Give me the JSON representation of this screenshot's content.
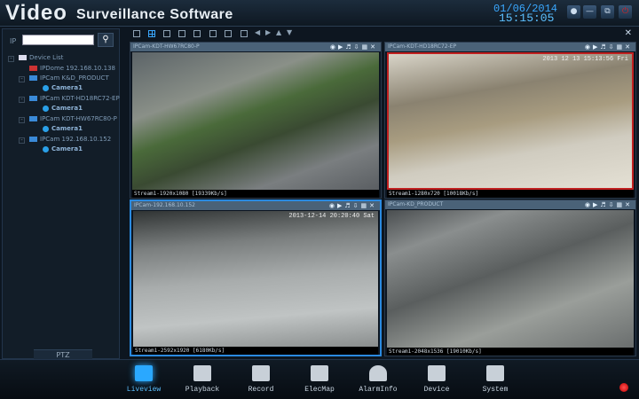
{
  "app": {
    "title_big": "Video",
    "title_rest": "Surveillance Software",
    "date": "01/06/2014",
    "time": "15:15:05"
  },
  "window_buttons": [
    "lock",
    "minimize",
    "restore",
    "power"
  ],
  "sidebar": {
    "ip_label": "IP",
    "ip_value": "",
    "tree": [
      {
        "label": "Device List",
        "type": "root"
      },
      {
        "label": "IPDome 192.168.10.138",
        "type": "device",
        "status": "offline"
      },
      {
        "label": "IPCam K&D_PRODUCT",
        "type": "device"
      },
      {
        "label": "Camera1",
        "type": "camera"
      },
      {
        "label": "IPCam KDT-HD18RC72-EP",
        "type": "device"
      },
      {
        "label": "Camera1",
        "type": "camera"
      },
      {
        "label": "IPCam KDT-HW67RC80-P",
        "type": "device"
      },
      {
        "label": "Camera1",
        "type": "camera"
      },
      {
        "label": "IPCam 192.168.10.152",
        "type": "device"
      },
      {
        "label": "Camera1",
        "type": "camera"
      }
    ],
    "ptz_label": "PTZ"
  },
  "cells": [
    {
      "title": "IPCam-KDT-HW67RC80-P",
      "stream": "Stream1-1920x1080 [19339Kb/s]",
      "osd": ""
    },
    {
      "title": "IPCam-KDT-HD18RC72-EP",
      "stream": "Stream1-1280x720 [10018Kb/s]",
      "osd": "2013 12 13 15:13:56 Fri"
    },
    {
      "title": "IPCam-192.168.10.152",
      "stream": "Stream1-2592x1920 [6180Kb/s]",
      "osd": "2013-12-14 20:20:40 Sat"
    },
    {
      "title": "IPCam-KD_PRODUCT",
      "stream": "Stream1-2048x1536 [19010Kb/s]",
      "osd": ""
    }
  ],
  "nav": [
    {
      "label": "Liveview",
      "active": true
    },
    {
      "label": "Playback"
    },
    {
      "label": "Record"
    },
    {
      "label": "ElecMap"
    },
    {
      "label": "AlarmInfo"
    },
    {
      "label": "Device"
    },
    {
      "label": "System"
    }
  ],
  "colors": {
    "accent": "#2aa8ff",
    "date": "#3aa8ff",
    "record": "#e00000"
  }
}
